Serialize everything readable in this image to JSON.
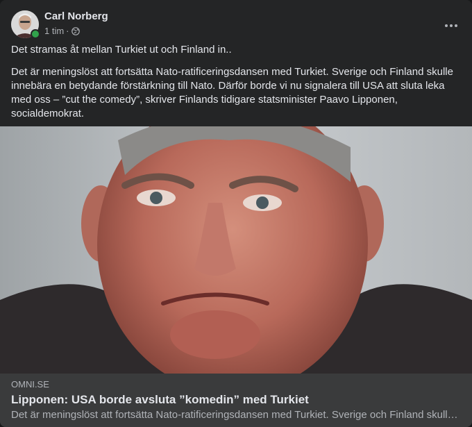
{
  "post": {
    "author": {
      "name": "Carl Norberg",
      "online": true
    },
    "time": "1 tim",
    "separator": "·",
    "audience_icon": "globe-icon",
    "more_icon": "more-horizontal-icon",
    "paragraphs": [
      "Det stramas åt mellan Turkiet ut och Finland in..",
      "Det är meningslöst att fortsätta Nato-ratificeringsdansen med Turkiet. Sverige och Finland skulle innebära en betydande förstärkning till Nato. Därför borde vi nu signalera till USA att sluta leka med oss – ”cut the comedy”, skriver Finlands tidigare statsminister Paavo Lipponen, socialdemokrat."
    ],
    "link_preview": {
      "domain": "OMNI.SE",
      "title": "Lipponen: USA borde avsluta ”komedin” med Turkiet",
      "description": "Det är meningslöst att fortsätta Nato-ratificeringsdansen med Turkiet. Sverige och Finland skulle innebära en betydande förstärkning till Nato."
    }
  },
  "colors": {
    "page_bg": "#18191a",
    "card_bg": "#242526",
    "preview_bg": "#3a3b3c",
    "primary_text": "#e4e6eb",
    "secondary_text": "#b0b3b8",
    "online": "#31a24c"
  }
}
